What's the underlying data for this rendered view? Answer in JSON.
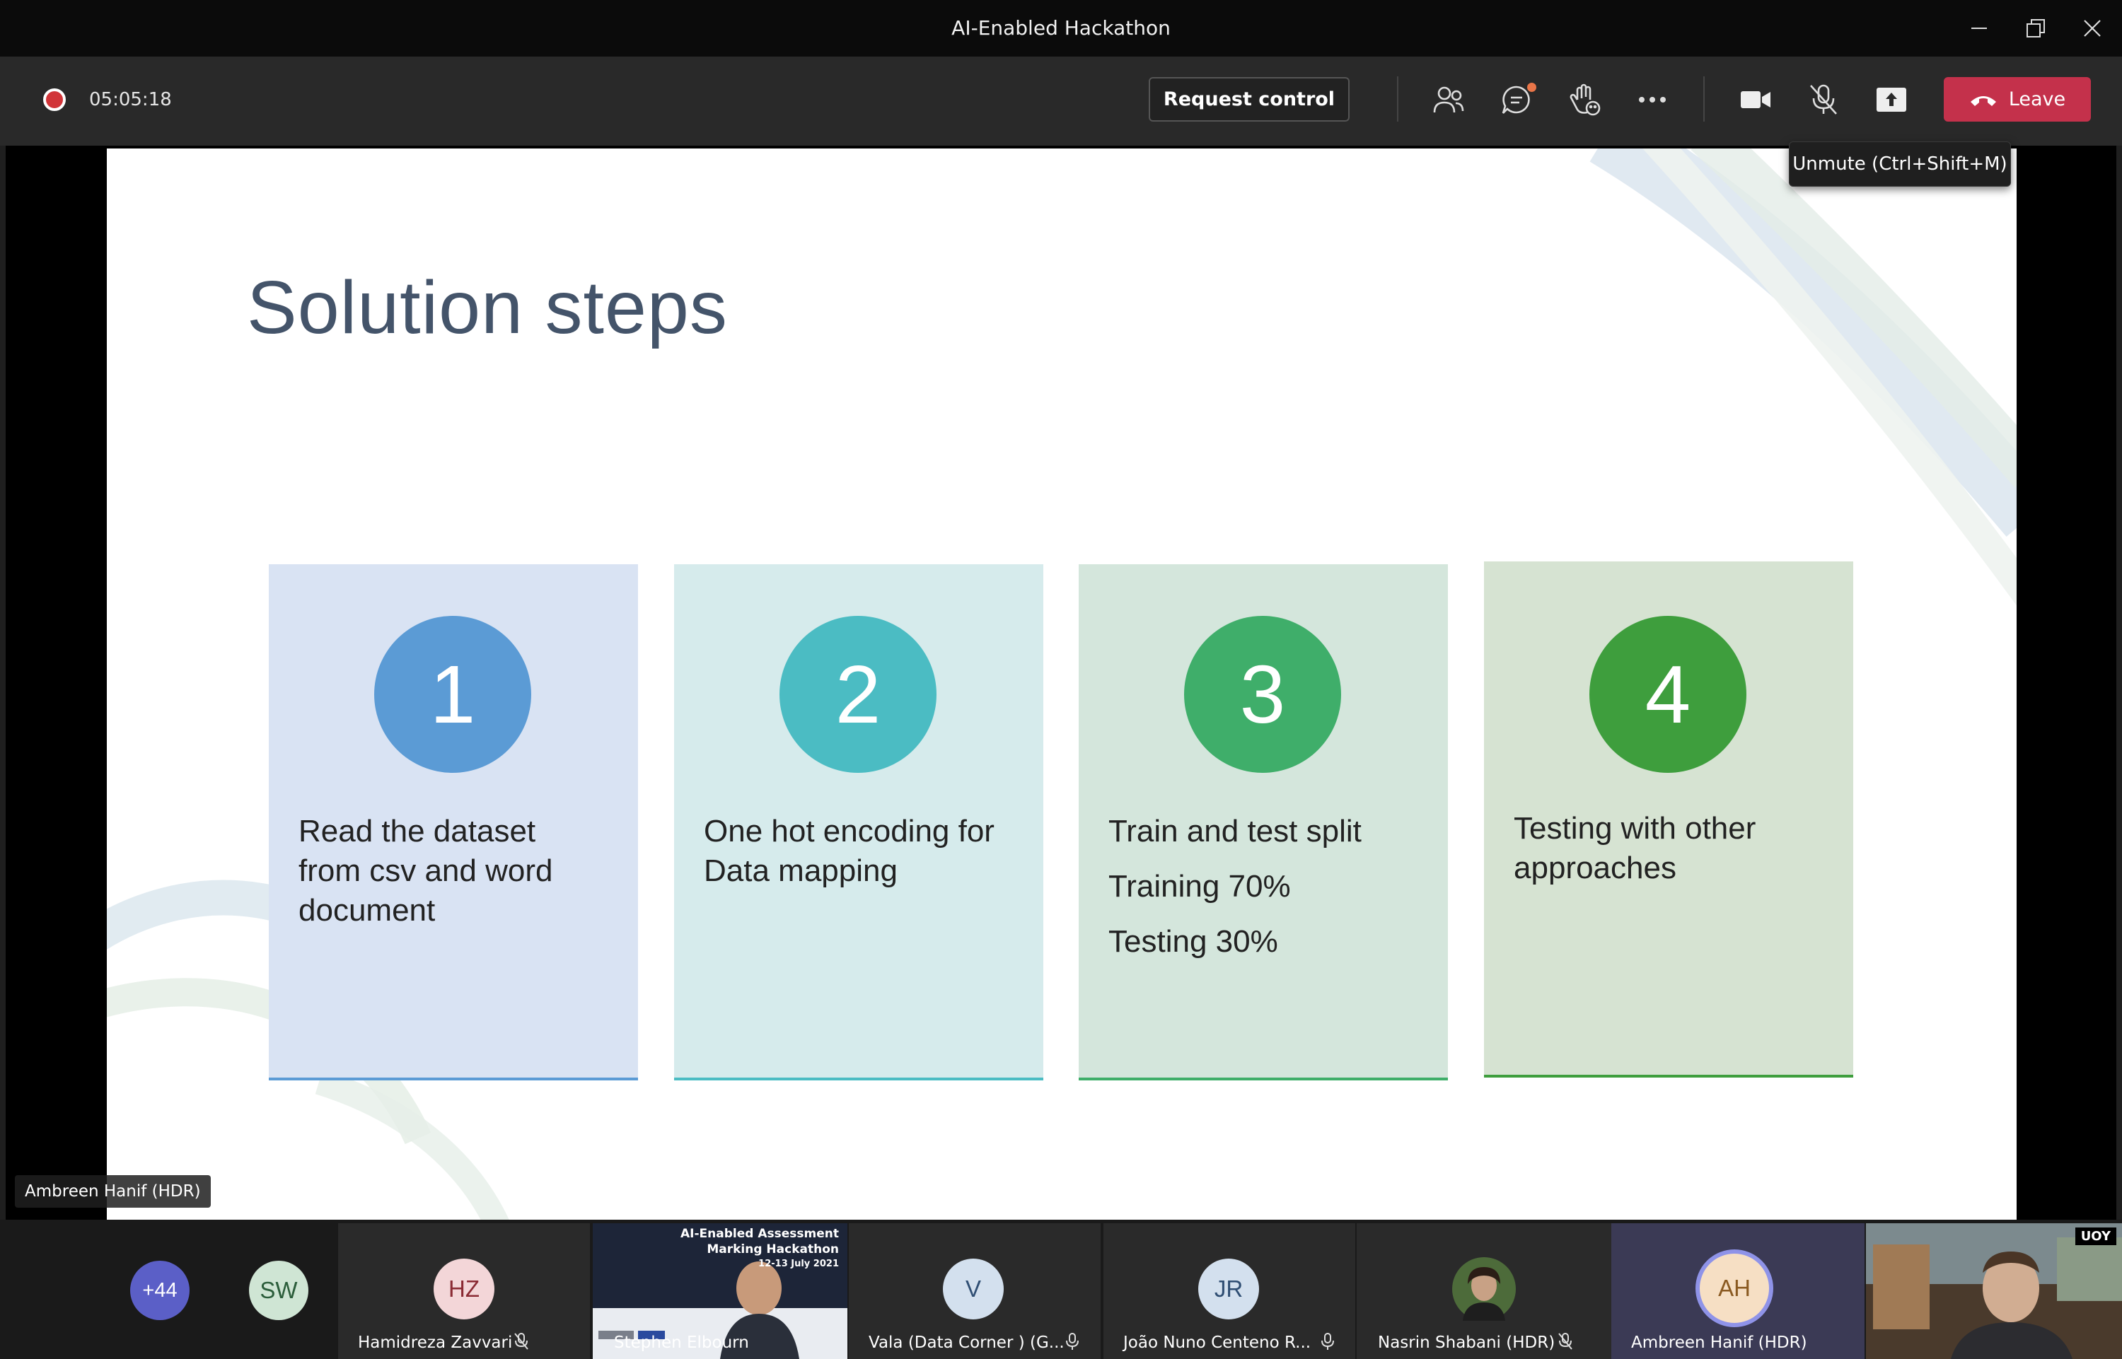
{
  "window": {
    "title": "AI-Enabled Hackathon"
  },
  "meeting": {
    "timer": "05:05:18",
    "request_control_label": "Request control",
    "leave_label": "Leave",
    "tooltip": "Unmute (Ctrl+Shift+M)",
    "icons": [
      "people-icon",
      "chat-icon",
      "reactions-icon",
      "more-icon",
      "camera-icon",
      "mic-muted-icon",
      "share-icon"
    ]
  },
  "slide": {
    "title": "Solution steps",
    "steps": [
      {
        "number": "1",
        "color": "#5b9bd5",
        "bg": "#d9e3f3",
        "underline": "#5b9bd5",
        "lines": [
          "Read the dataset",
          "from csv and word",
          "document"
        ]
      },
      {
        "number": "2",
        "color": "#4bbcc3",
        "bg": "#d6ebec",
        "underline": "#4bbcc3",
        "lines": [
          "One hot encoding for",
          "Data mapping"
        ]
      },
      {
        "number": "3",
        "color": "#3fae6a",
        "bg": "#d4e6dc",
        "underline": "#3fae6a",
        "lines": [
          "Train and test split",
          "Training 70%",
          "Testing 30%"
        ]
      },
      {
        "number": "4",
        "color": "#3e9e3d",
        "bg": "#d6e3d2",
        "underline": "#3e9e3d",
        "lines": [
          "Testing with other",
          "approaches"
        ]
      }
    ]
  },
  "presenter_label": "Ambreen Hanif (HDR)",
  "participants": {
    "overflow_count": "+44",
    "tiles": [
      {
        "initials": "SW",
        "name": "",
        "avatar_bg": "#cfe5d4",
        "avatar_fg": "#2b5d3a"
      },
      {
        "initials": "HZ",
        "name": "Hamidreza Zavvari",
        "avatar_bg": "#f3d6d8",
        "avatar_fg": "#8a2a33"
      },
      {
        "initials": "",
        "name": "Stephen Elbourn",
        "video_caption": "AI-Enabled Assessment Marking Hackathon",
        "video_subcaption": "12-13 July 2021"
      },
      {
        "initials": "V",
        "name": "Vala (Data Corner ) (G...",
        "avatar_bg": "#d3e0ee",
        "avatar_fg": "#2f4e73"
      },
      {
        "initials": "JR",
        "name": "João Nuno Centeno R...",
        "avatar_bg": "#d3e0ee",
        "avatar_fg": "#2f4e73"
      },
      {
        "initials": "",
        "name": "Nasrin Shabani (HDR)"
      },
      {
        "initials": "AH",
        "name": "Ambreen Hanif (HDR)",
        "avatar_bg": "#f6dfc4",
        "avatar_fg": "#8a5a21"
      },
      {
        "initials": "",
        "name": "",
        "video_badge": "UOY"
      }
    ]
  }
}
